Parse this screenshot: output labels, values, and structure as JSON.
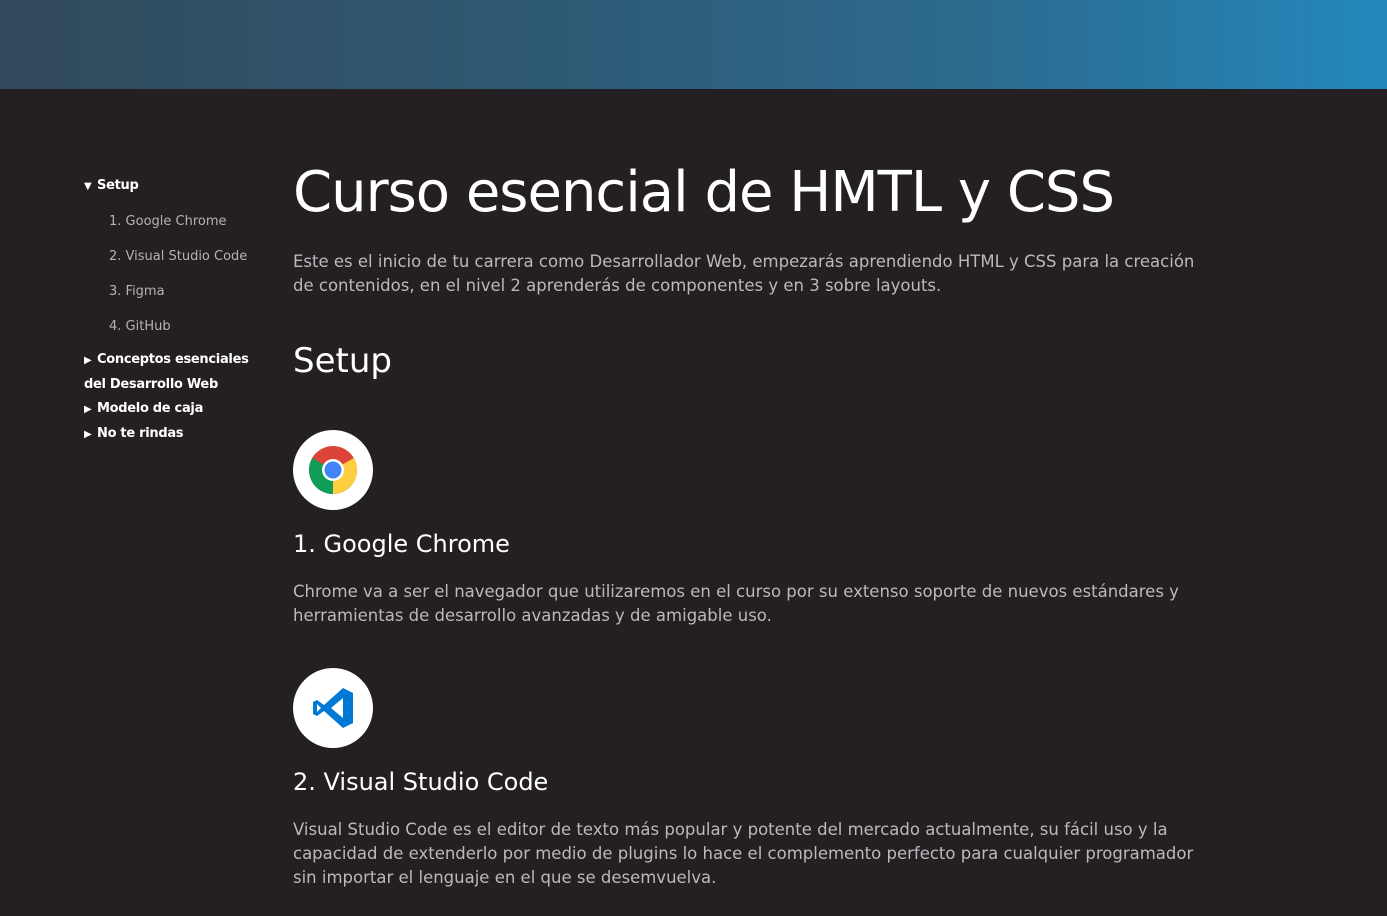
{
  "sidebar": {
    "setup_label": "Setup",
    "setup_items": [
      {
        "label": "1. Google Chrome"
      },
      {
        "label": "2. Visual Studio Code"
      },
      {
        "label": "3. Figma"
      },
      {
        "label": "4. GitHub"
      }
    ],
    "group_conceptos": "Conceptos esenciales del Desarrollo Web",
    "group_modelo": "Modelo de caja",
    "group_rindas": "No te rindas",
    "expanded_marker": "▼",
    "collapsed_marker": "▶"
  },
  "main": {
    "title": "Curso esencial de HMTL y CSS",
    "intro": "Este es el inicio de tu carrera como Desarrollador Web, empezarás aprendiendo HTML y CSS para la creación de contenidos, en el nivel 2 aprenderás de componentes y en 3 sobre layouts.",
    "section_title": "Setup",
    "tools": [
      {
        "title": "1. Google Chrome",
        "description": "Chrome va a ser el navegador que utilizaremos en el curso por su extenso soporte de nuevos estándares y herramientas de desarrollo avanzadas y de amigable uso.",
        "icon": "chrome-icon"
      },
      {
        "title": "2. Visual Studio Code",
        "description": "Visual Studio Code es el editor de texto más popular y potente del mercado actualmente, su fácil uso y la capacidad de extenderlo por medio de plugins lo hace el complemento perfecto para cualquier programador sin importar el lenguaje en el que se desemvuelva.",
        "icon": "vscode-icon"
      }
    ]
  },
  "colors": {
    "background": "#241f23",
    "banner_start": "#31495a",
    "banner_end": "#2388bb",
    "muted_text": "#bdb8bc"
  }
}
